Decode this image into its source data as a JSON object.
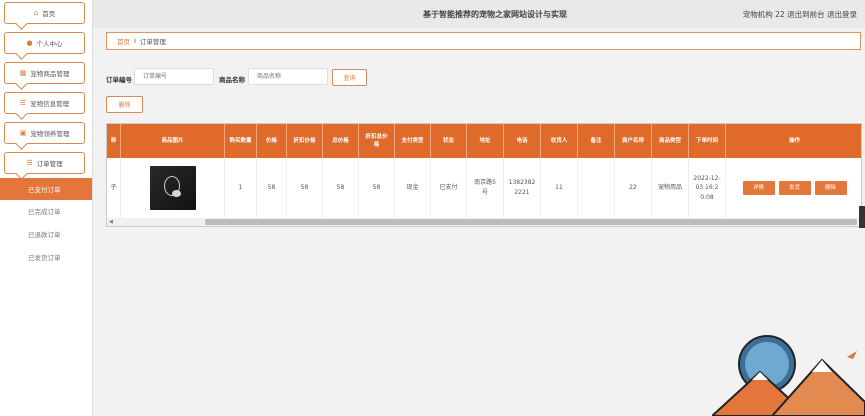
{
  "app": {
    "title": "基于智能推荐的宠物之家网站设计与实现",
    "user": "宠物机构 22",
    "back_to_front": "退出到前台",
    "logout": "退出登录"
  },
  "sidebar": {
    "menus": [
      {
        "label": "首页",
        "icon": "home-icon"
      },
      {
        "label": "个人中心",
        "icon": "user-icon"
      },
      {
        "label": "宠物商品管理",
        "icon": "grid-icon"
      },
      {
        "label": "宠物信息管理",
        "icon": "list-icon"
      },
      {
        "label": "宠物领养管理",
        "icon": "cart-icon"
      },
      {
        "label": "订单管理",
        "icon": "list-icon"
      }
    ],
    "submenu": [
      "已支付订单",
      "已完成订单",
      "已退款订单",
      "已发货订单"
    ],
    "active_submenu": "已支付订单"
  },
  "breadcrumb": {
    "home": "首页",
    "sep": "I",
    "current": "订单管理"
  },
  "search": {
    "order_no_label": "订单编号",
    "order_no_placeholder": "订单编号",
    "product_label": "商品名称",
    "product_placeholder": "商品名称",
    "query_button": "查询",
    "delete_button": "删除"
  },
  "table": {
    "headers": [
      "称",
      "商品图片",
      "购买数量",
      "价格",
      "折扣价格",
      "总价格",
      "折扣总价格",
      "支付类型",
      "状态",
      "地址",
      "电话",
      "收货人",
      "备注",
      "商户名称",
      "商品类型",
      "下单时间",
      "操作"
    ],
    "rows": [
      {
        "name_fragment": "子",
        "qty": "1",
        "price": "58",
        "discount_price": "58",
        "total": "58",
        "discount_total": "58",
        "pay_type": "现金",
        "status": "已支付",
        "address": "南京路5号",
        "phone": "13823822221",
        "receiver": "11",
        "remark": "",
        "merchant": "22",
        "product_type": "宠物用品",
        "order_time": "2022-12-03 16:20:08",
        "actions": [
          "详情",
          "发货",
          "删除"
        ]
      }
    ]
  },
  "colors": {
    "accent": "#e3763a",
    "header": "#e06a2a"
  }
}
